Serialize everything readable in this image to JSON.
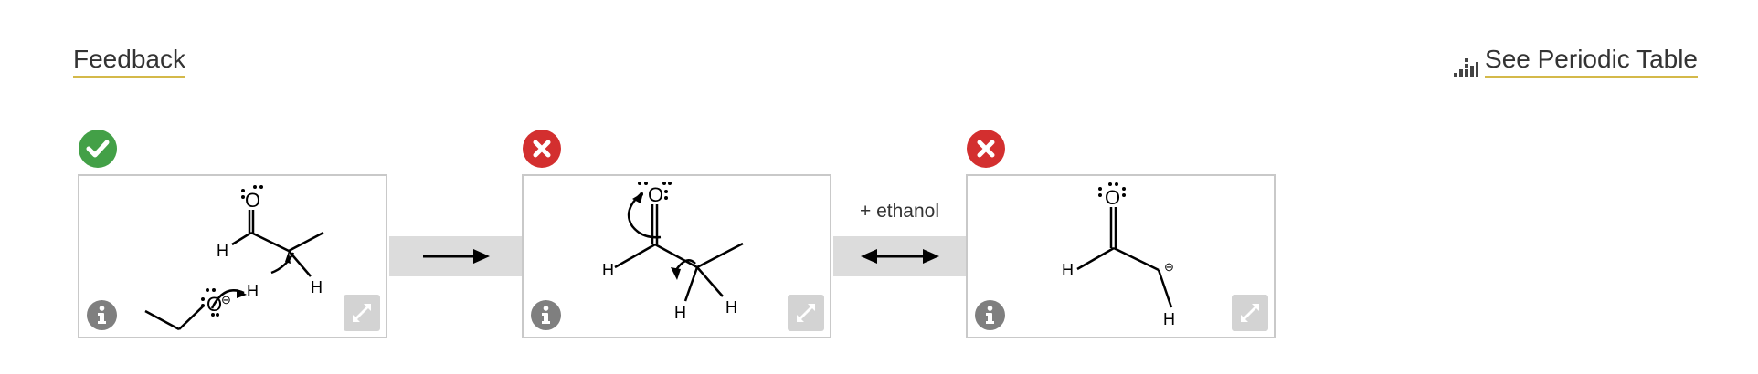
{
  "header": {
    "feedback_label": "Feedback",
    "periodic_table_label": "See Periodic Table",
    "periodic_table_icon": "bar-chart-icon"
  },
  "colors": {
    "correct": "#43a047",
    "incorrect": "#d32f2f",
    "link_underline": "#d4b94a",
    "panel_border": "#c9c9c9",
    "connector_bg": "#dcdcdc"
  },
  "steps": [
    {
      "status": "correct",
      "status_icon": "check-circle-icon",
      "atoms": [
        "O",
        "H",
        "H",
        "O",
        "H"
      ],
      "charges": [
        "⊖"
      ],
      "info_icon": "info-icon",
      "expand_icon": "expand-icon"
    },
    {
      "status": "incorrect",
      "status_icon": "x-circle-icon",
      "atoms": [
        "O",
        "H",
        "H",
        "H"
      ],
      "info_icon": "info-icon",
      "expand_icon": "expand-icon"
    },
    {
      "status": "incorrect",
      "status_icon": "x-circle-icon",
      "atoms": [
        "O",
        "H",
        "H"
      ],
      "charges": [
        "⊖"
      ],
      "info_icon": "info-icon",
      "expand_icon": "expand-icon"
    }
  ],
  "connectors": [
    {
      "type": "reaction-arrow",
      "icon": "right-arrow-icon",
      "label": ""
    },
    {
      "type": "resonance-arrow",
      "icon": "double-headed-arrow-icon",
      "label": "+ ethanol"
    }
  ]
}
